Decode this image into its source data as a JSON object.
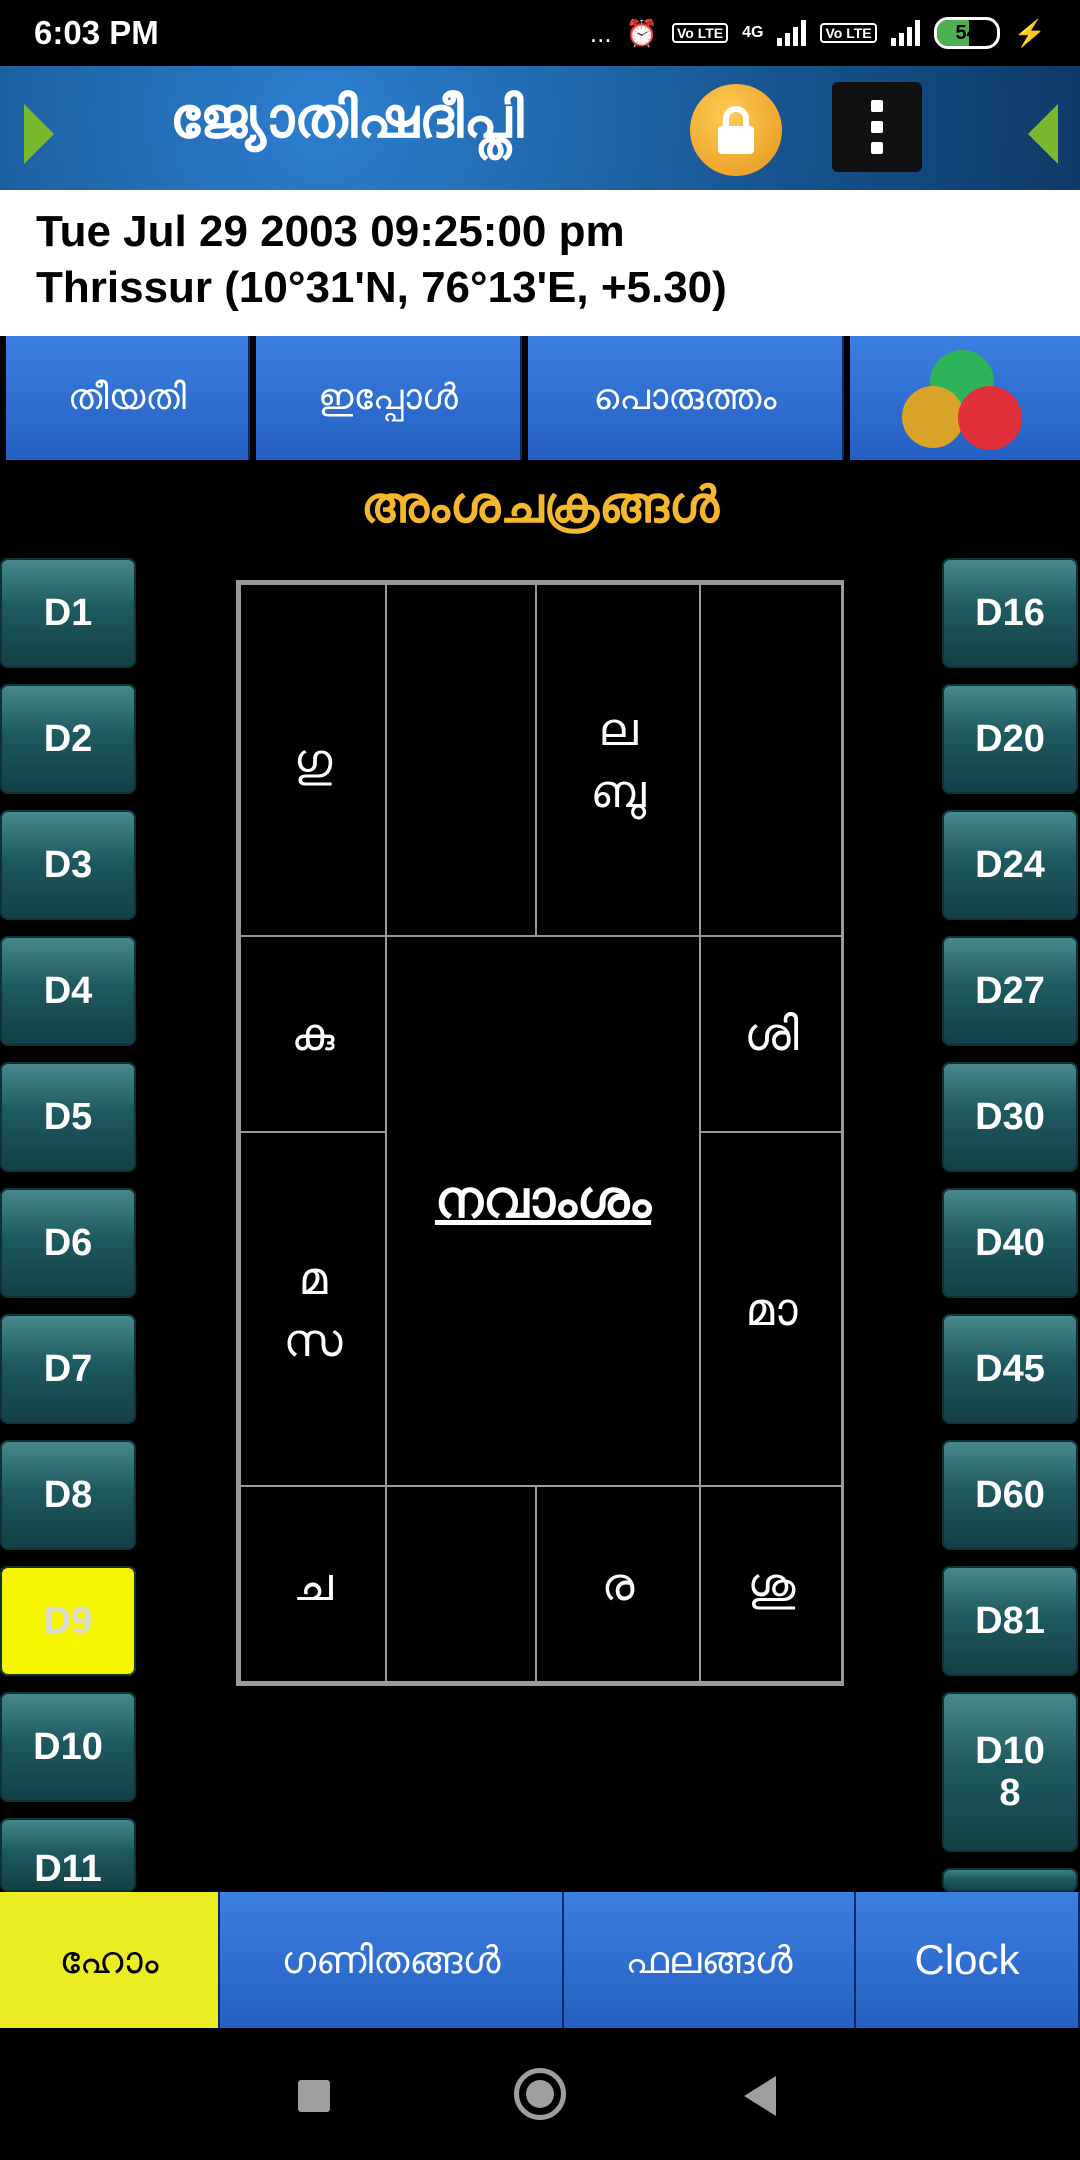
{
  "status_bar": {
    "time": "6:03 PM",
    "dots": "...",
    "network_label": "4G",
    "volte_label_1": "Vo LTE",
    "volte_label_2": "Vo LTE",
    "battery": "54",
    "battery_level": 0.54
  },
  "header": {
    "title": "ജ്യോതിഷദീപ്തി"
  },
  "info": {
    "datetime": "Tue Jul 29 2003 09:25:00 pm",
    "location": "Thrissur (10°31'N, 76°13'E, +5.30)"
  },
  "top_buttons": {
    "date": "തീയതി",
    "now": "ഇപ്പോൾ",
    "match": "പൊരുത്തം"
  },
  "section_title": "അംശചക്രങ്ങൾ",
  "left_divisions": [
    "D1",
    "D2",
    "D3",
    "D4",
    "D5",
    "D6",
    "D7",
    "D8",
    "D9",
    "D10",
    "D11"
  ],
  "right_divisions": [
    "D16",
    "D20",
    "D24",
    "D27",
    "D30",
    "D40",
    "D45",
    "D60",
    "D81",
    "D10 8"
  ],
  "selected_division": "D9",
  "chart": {
    "title": "നവാംശം",
    "cells": {
      "r1c1": "ഗു",
      "r1c2": "",
      "r1c3_line1": "ല",
      "r1c3_line2": "ബു",
      "r1c4": "",
      "r2c1": "കു",
      "r2c4": "ശി",
      "r3c1_line1": "മ",
      "r3c1_line2": "സ",
      "r3c4": "മാ",
      "r4c1": "ച",
      "r4c2": "",
      "r4c3": "ര",
      "r4c4": "ശു"
    }
  },
  "bottom_nav": {
    "home": "ഹോം",
    "calculations": "ഗണിതങ്ങൾ",
    "results": "ഫലങ്ങൾ",
    "clock": "Clock"
  },
  "colors": {
    "accent_blue": "#2d6fd6",
    "section_title": "#f5b72e",
    "active_yellow": "#f5f500",
    "side_button": "#1d5a60"
  }
}
